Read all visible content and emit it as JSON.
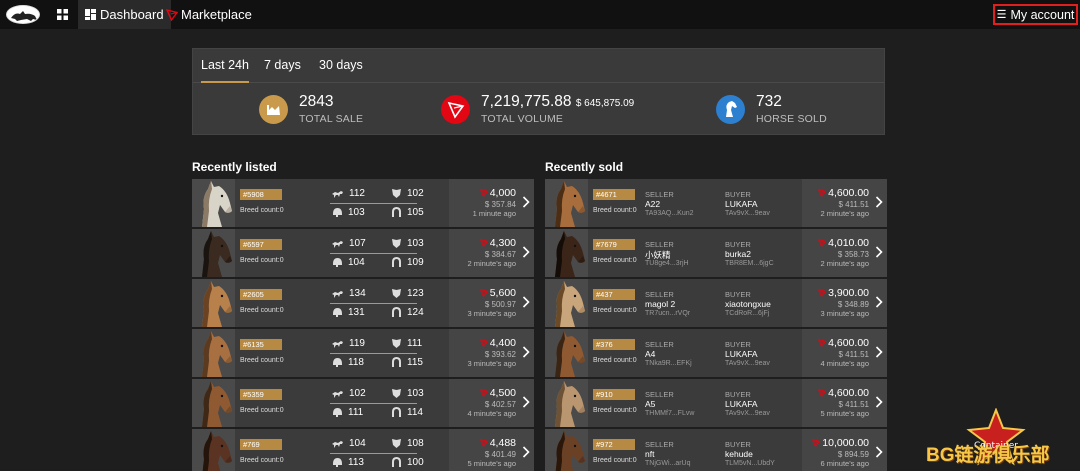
{
  "nav": {
    "dashboard_label": "Dashboard",
    "marketplace_label": "Marketplace",
    "account_label": "My account"
  },
  "stats": {
    "tabs": [
      "Last 24h",
      "7 days",
      "30 days"
    ],
    "active_tab": "Last 24h",
    "total_sale_value": "2843",
    "total_sale_label": "TOTAL SALE",
    "total_volume_value": "7,219,775.88",
    "total_volume_usd": "$ 645,875.09",
    "total_volume_label": "TOTAL VOLUME",
    "horse_sold_value": "732",
    "horse_sold_label": "HORSE SOLD"
  },
  "colors": {
    "accent": "#c99a4b",
    "tron": "#e30613",
    "horse_icon_bg": "#2d7fd0",
    "account_border": "#e01f1f"
  },
  "recently_listed": {
    "title": "Recently listed",
    "items": [
      {
        "id": "#5908",
        "breed": "Breed count:0",
        "speed": "112",
        "stamina": "102",
        "helmet": "103",
        "shoe": "105",
        "price": "4,000",
        "usd": "$ 357.84",
        "ago": "1 minute ago"
      },
      {
        "id": "#6597",
        "breed": "Breed count:0",
        "speed": "107",
        "stamina": "103",
        "helmet": "104",
        "shoe": "109",
        "price": "4,300",
        "usd": "$ 384.67",
        "ago": "2 minute's ago"
      },
      {
        "id": "#2605",
        "breed": "Breed count:0",
        "speed": "134",
        "stamina": "123",
        "helmet": "131",
        "shoe": "124",
        "price": "5,600",
        "usd": "$ 500.97",
        "ago": "3 minute's ago"
      },
      {
        "id": "#6135",
        "breed": "Breed count:0",
        "speed": "119",
        "stamina": "111",
        "helmet": "118",
        "shoe": "115",
        "price": "4,400",
        "usd": "$ 393.62",
        "ago": "3 minute's ago"
      },
      {
        "id": "#5359",
        "breed": "Breed count:0",
        "speed": "102",
        "stamina": "103",
        "helmet": "111",
        "shoe": "114",
        "price": "4,500",
        "usd": "$ 402.57",
        "ago": "4 minute's ago"
      },
      {
        "id": "#769",
        "breed": "Breed count:0",
        "speed": "104",
        "stamina": "108",
        "helmet": "113",
        "shoe": "100",
        "price": "4,488",
        "usd": "$ 401.49",
        "ago": "5 minute's ago"
      }
    ]
  },
  "recently_sold": {
    "title": "Recently sold",
    "seller_label": "SELLER",
    "buyer_label": "BUYER",
    "items": [
      {
        "id": "#4671",
        "breed": "Breed count:0",
        "seller": "A22",
        "seller_addr": "TA93AQ...Kun2",
        "buyer": "LUKAFA",
        "buyer_addr": "TAv9vX...9eav",
        "price": "4,600.00",
        "usd": "$ 411.51",
        "ago": "2 minute's ago"
      },
      {
        "id": "#7679",
        "breed": "Breed count:0",
        "seller": "小妖精",
        "seller_addr": "TU8ge4...3rjH",
        "buyer": "burka2",
        "buyer_addr": "TBR8EM...6jgC",
        "price": "4,010.00",
        "usd": "$ 358.73",
        "ago": "2 minute's ago"
      },
      {
        "id": "#437",
        "breed": "Breed count:0",
        "seller": "magol 2",
        "seller_addr": "TR7ucn...rVQr",
        "buyer": "xiaotongxue",
        "buyer_addr": "TCdRoR...6jFj",
        "price": "3,900.00",
        "usd": "$ 348.89",
        "ago": "3 minute's ago"
      },
      {
        "id": "#376",
        "breed": "Breed count:0",
        "seller": "A4",
        "seller_addr": "TNka9R...EFKj",
        "buyer": "LUKAFA",
        "buyer_addr": "TAv9vX...9eav",
        "price": "4,600.00",
        "usd": "$ 411.51",
        "ago": "4 minute's ago"
      },
      {
        "id": "#910",
        "breed": "Breed count:0",
        "seller": "A5",
        "seller_addr": "THMMf7...FLvw",
        "buyer": "LUKAFA",
        "buyer_addr": "TAv9vX...9eav",
        "price": "4,600.00",
        "usd": "$ 411.51",
        "ago": "5 minute's ago"
      },
      {
        "id": "#972",
        "breed": "Breed count:0",
        "seller": "nft",
        "seller_addr": "TNjGWi...arUq",
        "buyer": "kehude",
        "buyer_addr": "TLM5vN...UbdY",
        "price": "10,000.00",
        "usd": "$ 894.59",
        "ago": "6 minute's ago"
      }
    ]
  },
  "watermark": {
    "text": "BG链游俱乐部",
    "badge": "Container"
  }
}
